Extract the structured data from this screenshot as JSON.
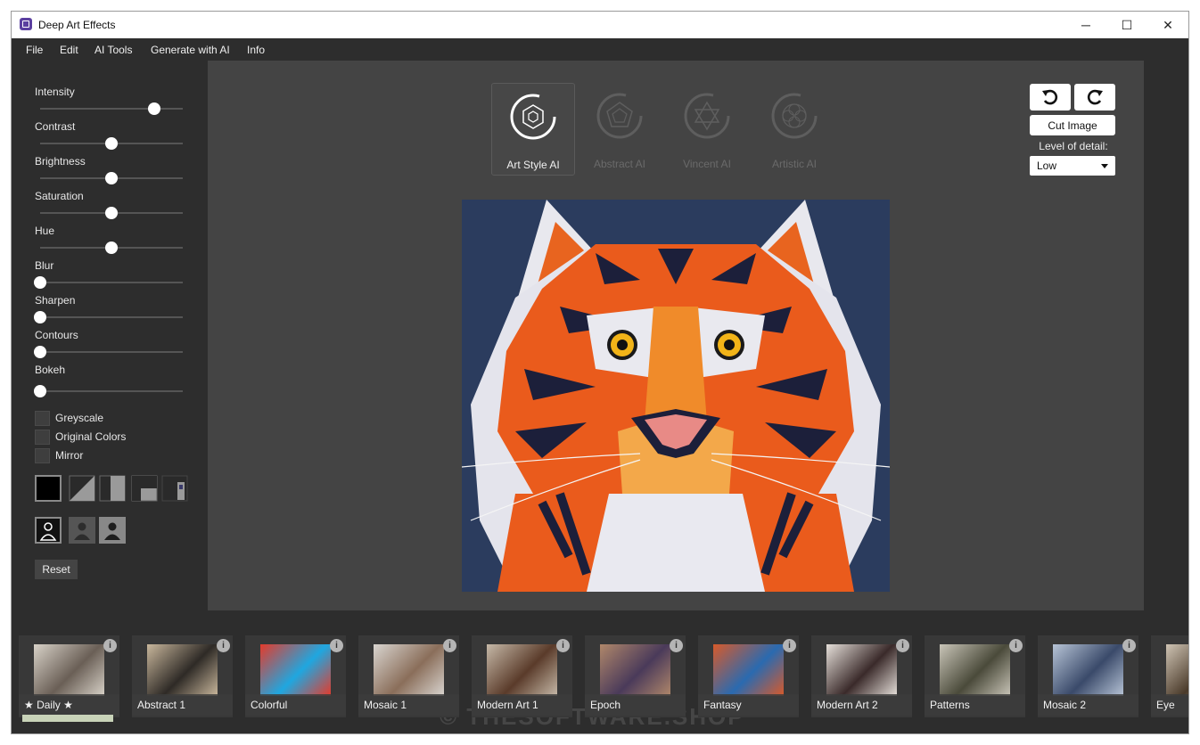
{
  "window": {
    "title": "Deep Art Effects",
    "controls": {
      "minimize": "─",
      "maximize": "☐",
      "close": "✕"
    }
  },
  "menu": [
    "File",
    "Edit",
    "AI Tools",
    "Generate with AI",
    "Info"
  ],
  "adjustments": [
    {
      "label": "Intensity",
      "value": 0.8
    },
    {
      "label": "Contrast",
      "value": 0.5
    },
    {
      "label": "Brightness",
      "value": 0.5
    },
    {
      "label": "Saturation",
      "value": 0.5
    },
    {
      "label": "Hue",
      "value": 0.5
    },
    {
      "label": "Blur",
      "value": 0.0
    },
    {
      "label": "Sharpen",
      "value": 0.0
    },
    {
      "label": "Contours",
      "value": 0.0
    },
    {
      "label": "Bokeh",
      "value": 0.0
    }
  ],
  "checkboxes": [
    {
      "label": "Greyscale",
      "checked": false
    },
    {
      "label": "Original Colors",
      "checked": false
    },
    {
      "label": "Mirror",
      "checked": false
    }
  ],
  "blend_modes": [
    "full-mode-icon",
    "diagonal-split-icon",
    "vertical-split-icon",
    "corner-split-icon",
    "small-split-icon"
  ],
  "subject_modes": [
    "person-outline-icon",
    "person-filled-icon",
    "person-background-icon"
  ],
  "reset_label": "Reset",
  "styles": [
    {
      "label": "Art Style AI",
      "active": true,
      "icon": "hexagon-icon"
    },
    {
      "label": "Abstract AI",
      "active": false,
      "icon": "pentagon-icon"
    },
    {
      "label": "Vincent AI",
      "active": false,
      "icon": "star-of-david-icon"
    },
    {
      "label": "Artistic AI",
      "active": false,
      "icon": "flower-icon"
    }
  ],
  "toolbar": {
    "undo_icon": "undo-icon",
    "redo_icon": "redo-icon",
    "cut_label": "Cut Image",
    "detail_label": "Level of detail:",
    "detail_value": "Low"
  },
  "filters": [
    {
      "label": "★ Daily ★",
      "colors": [
        "#d8d2c8",
        "#6a5f56"
      ]
    },
    {
      "label": "Abstract 1",
      "colors": [
        "#c9b79c",
        "#2e2a26"
      ]
    },
    {
      "label": "Colorful",
      "colors": [
        "#e53a2a",
        "#1fa7e0"
      ]
    },
    {
      "label": "Mosaic 1",
      "colors": [
        "#d9d5d0",
        "#8a6e5a"
      ]
    },
    {
      "label": "Modern Art 1",
      "colors": [
        "#c6b9a8",
        "#5a3b2a"
      ]
    },
    {
      "label": "Epoch",
      "colors": [
        "#b0876a",
        "#4a3a5a"
      ]
    },
    {
      "label": "Fantasy",
      "colors": [
        "#d85a2a",
        "#2a6ab0"
      ]
    },
    {
      "label": "Modern Art 2",
      "colors": [
        "#e6e0da",
        "#3a2a2a"
      ]
    },
    {
      "label": "Patterns",
      "colors": [
        "#c9c5b8",
        "#4a4a3a"
      ]
    },
    {
      "label": "Mosaic 2",
      "colors": [
        "#b7c4d6",
        "#3a4a6a"
      ]
    },
    {
      "label": "Eye",
      "colors": [
        "#cfc4b4",
        "#4a3a2a"
      ]
    }
  ],
  "watermark": "© THESOFTWARE.SHOP",
  "colors": {
    "background": "#2d2d2d",
    "canvas": "#444444",
    "tiger_orange": "#e85a22",
    "tiger_bg": "#2a3a5c"
  }
}
